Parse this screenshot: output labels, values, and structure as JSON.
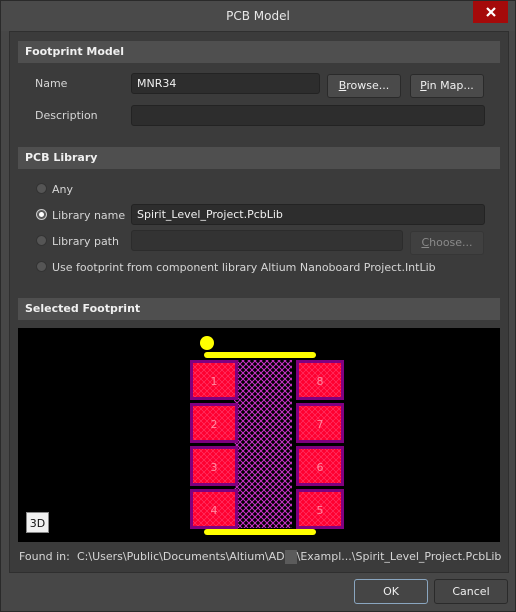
{
  "window": {
    "title": "PCB Model",
    "close_icon": "close-icon"
  },
  "footprint_model": {
    "header": "Footprint Model",
    "name_label": "Name",
    "name_value": "MNR34",
    "browse_label": "Browse...",
    "browse_accel": "B",
    "browse_rest": "rowse...",
    "pinmap_accel": "P",
    "pinmap_rest": "in Map...",
    "description_label": "Description",
    "description_value": ""
  },
  "pcb_library": {
    "header": "PCB Library",
    "options": [
      {
        "label": "Any",
        "checked": false
      },
      {
        "label": "Library name",
        "checked": true
      },
      {
        "label": "Library path",
        "checked": false
      },
      {
        "label": "Use footprint from component library Altium Nanoboard Project.IntLib",
        "checked": false
      }
    ],
    "library_name_value": "Spirit_Level_Project.PcbLib",
    "library_path_value": "",
    "choose_accel": "C",
    "choose_rest": "hoose..."
  },
  "selected_footprint": {
    "header": "Selected Footprint",
    "view_3d_label": "3D",
    "pads_left": [
      "1",
      "2",
      "3",
      "4"
    ],
    "pads_right": [
      "8",
      "7",
      "6",
      "5"
    ],
    "colors": {
      "pad": "#ff0030",
      "pad_border": "#800080",
      "silkscreen": "#ffff00",
      "body_hatch": "#cc33cc",
      "background": "#000000"
    }
  },
  "found_in": {
    "label": "Found in:",
    "path_start": "C:\\Users\\Public\\Documents\\Altium\\AD",
    "path_end": "\\Exampl...\\Spirit_Level_Project.PcbLib"
  },
  "footer": {
    "ok_label": "OK",
    "cancel_label": "Cancel"
  }
}
